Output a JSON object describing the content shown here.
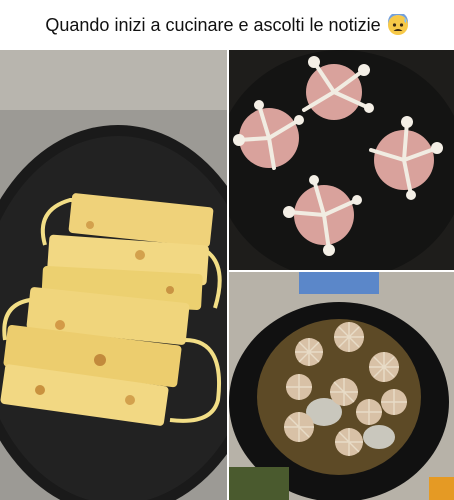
{
  "caption": {
    "text": "Quando inizi a cucinare e ascolti le notizie",
    "emoji": "anxious-face-with-sweat-icon"
  },
  "photos": [
    {
      "name": "mask-shaped-omelettes-in-pan"
    },
    {
      "name": "virus-shaped-meatballs-frying"
    },
    {
      "name": "virus-shaped-meatballs-in-broth"
    }
  ],
  "colors": {
    "pan": "#1b1b1b",
    "omelette": "#f0d77a",
    "meat": "#d9a6a0",
    "mushroom": "#f4efe6",
    "broth": "#6b5a35"
  }
}
